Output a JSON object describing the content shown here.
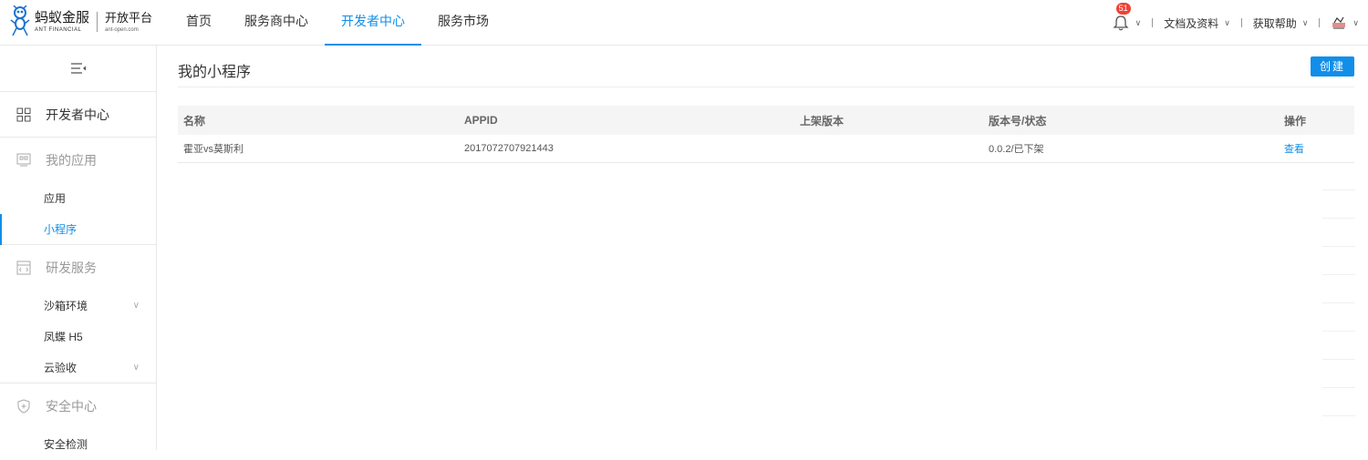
{
  "header": {
    "brand_cn": "蚂蚁金服",
    "brand_en": "ANT FINANCIAL",
    "platform_cn": "开放平台",
    "platform_en": "ant-open.com",
    "nav": [
      "首页",
      "服务商中心",
      "开发者中心",
      "服务市场"
    ],
    "active_nav": "开发者中心",
    "notification_count": "51",
    "docs_label": "文档及资料",
    "help_label": "获取帮助"
  },
  "sidebar": {
    "dev_center": "开发者中心",
    "my_apps": "我的应用",
    "apps": "应用",
    "mini_programs": "小程序",
    "rd_services": "研发服务",
    "sandbox": "沙箱环境",
    "fengdie": "凤蝶 H5",
    "cloud_acceptance": "云验收",
    "security_center": "安全中心",
    "security_check": "安全检测"
  },
  "main": {
    "title": "我的小程序",
    "create_label": "创建",
    "columns": [
      "名称",
      "APPID",
      "上架版本",
      "版本号/状态",
      "操作"
    ],
    "rows": [
      {
        "name": "霍亚vs莫斯利",
        "appid": "2017072707921443",
        "listed_version": "",
        "version_status": "0.0.2/已下架",
        "action": "查看"
      }
    ]
  },
  "colors": {
    "accent": "#108ee9",
    "badge": "#f04134"
  }
}
